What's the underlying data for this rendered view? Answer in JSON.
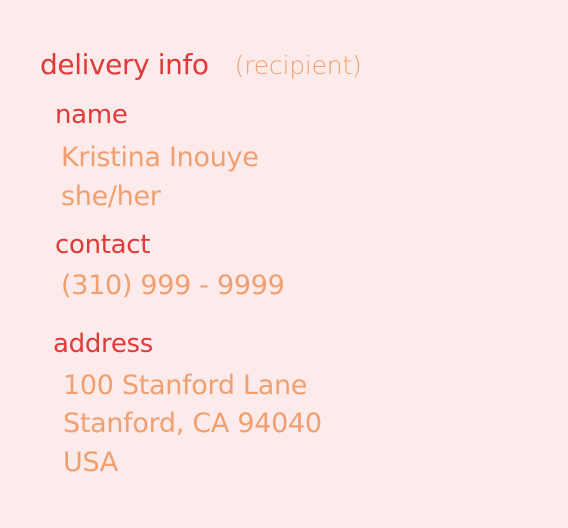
{
  "header": {
    "title": "delivery info",
    "subtitle": "(recipient)"
  },
  "name": {
    "label": "name",
    "full_name": "Kristina Inouye",
    "pronouns": "she/her"
  },
  "contact": {
    "label": "contact",
    "phone": "(310) 999 - 9999"
  },
  "address": {
    "label": "address",
    "line1": "100 Stanford Lane",
    "line2": "Stanford, CA 94040",
    "line3": "USA"
  },
  "colors": {
    "background": "#FCEBEA",
    "label": "#E03A3A",
    "value": "#F0A070"
  }
}
